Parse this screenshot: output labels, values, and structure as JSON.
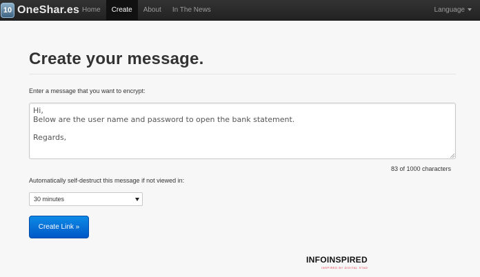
{
  "navbar": {
    "logo_glyph": "10",
    "brand": "OneShar.es",
    "items": [
      {
        "label": "Home",
        "active": false
      },
      {
        "label": "Create",
        "active": true
      },
      {
        "label": "About",
        "active": false
      },
      {
        "label": "In The News",
        "active": false
      }
    ],
    "language_label": "Language",
    "language_icon": "caret-down-icon"
  },
  "page": {
    "title": "Create your message.",
    "message_label": "Enter a message that you want to encrypt:",
    "message_value": "Hi,\nBelow are the user name and password to open the bank statement.\n\nRegards,",
    "char_count": "83 of 1000 characters",
    "destruct_label": "Automatically self-destruct this message if not viewed in:",
    "destruct_selected": "30 minutes",
    "create_button": "Create Link »"
  },
  "watermark": {
    "main": "INFOINSPIRED",
    "sub": "INSPIRED BY DIGITAL STAD"
  },
  "colors": {
    "navbar_bg": "#222222",
    "button_blue": "#0a6fd8",
    "watermark_red": "#e8263a"
  }
}
